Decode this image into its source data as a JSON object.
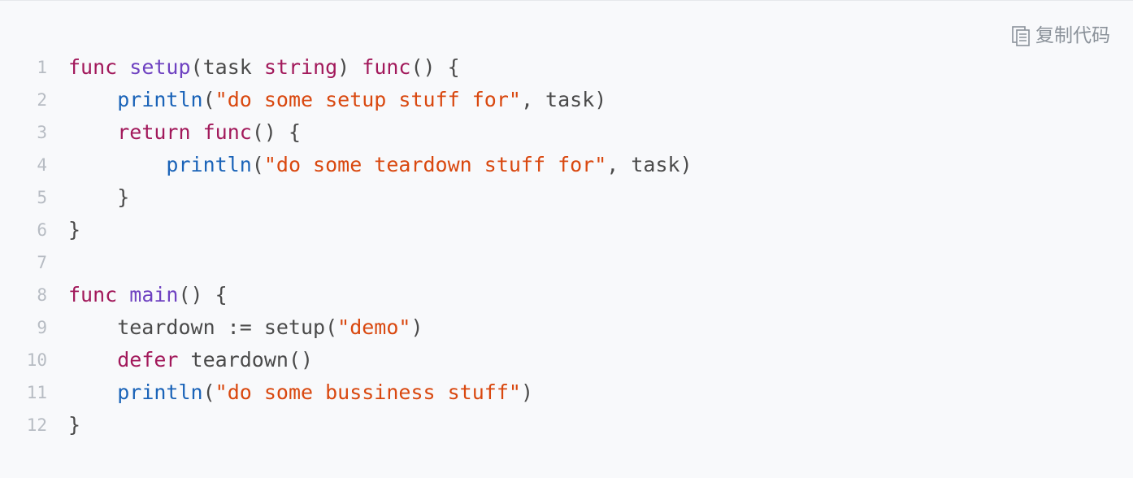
{
  "toolbar": {
    "copy_label": "复制代码",
    "copy_icon": "copy-icon"
  },
  "colors": {
    "background": "#f8f9fb",
    "keyword": "#a2195b",
    "function_name": "#6f42c1",
    "builtin": "#1a63b8",
    "string": "#d9480f",
    "plain": "#4a4a4a",
    "line_number": "#b7bcc3"
  },
  "code": {
    "language": "go",
    "lines": [
      {
        "number": "1",
        "tokens": [
          {
            "text": "func",
            "type": "keyword"
          },
          {
            "text": " ",
            "type": "plain"
          },
          {
            "text": "setup",
            "type": "func"
          },
          {
            "text": "(task ",
            "type": "plain"
          },
          {
            "text": "string",
            "type": "keyword"
          },
          {
            "text": ") ",
            "type": "plain"
          },
          {
            "text": "func",
            "type": "keyword"
          },
          {
            "text": "() {",
            "type": "plain"
          }
        ]
      },
      {
        "number": "2",
        "tokens": [
          {
            "text": "    ",
            "type": "plain"
          },
          {
            "text": "println",
            "type": "builtin"
          },
          {
            "text": "(",
            "type": "plain"
          },
          {
            "text": "\"do some setup stuff for\"",
            "type": "string"
          },
          {
            "text": ", task)",
            "type": "plain"
          }
        ]
      },
      {
        "number": "3",
        "tokens": [
          {
            "text": "    ",
            "type": "plain"
          },
          {
            "text": "return",
            "type": "keyword"
          },
          {
            "text": " ",
            "type": "plain"
          },
          {
            "text": "func",
            "type": "keyword"
          },
          {
            "text": "() {",
            "type": "plain"
          }
        ]
      },
      {
        "number": "4",
        "tokens": [
          {
            "text": "        ",
            "type": "plain"
          },
          {
            "text": "println",
            "type": "builtin"
          },
          {
            "text": "(",
            "type": "plain"
          },
          {
            "text": "\"do some teardown stuff for\"",
            "type": "string"
          },
          {
            "text": ", task)",
            "type": "plain"
          }
        ]
      },
      {
        "number": "5",
        "tokens": [
          {
            "text": "    }",
            "type": "plain"
          }
        ]
      },
      {
        "number": "6",
        "tokens": [
          {
            "text": "}",
            "type": "plain"
          }
        ]
      },
      {
        "number": "7",
        "tokens": []
      },
      {
        "number": "8",
        "tokens": [
          {
            "text": "func",
            "type": "keyword"
          },
          {
            "text": " ",
            "type": "plain"
          },
          {
            "text": "main",
            "type": "func"
          },
          {
            "text": "() {",
            "type": "plain"
          }
        ]
      },
      {
        "number": "9",
        "tokens": [
          {
            "text": "    teardown := setup(",
            "type": "plain"
          },
          {
            "text": "\"demo\"",
            "type": "string"
          },
          {
            "text": ")",
            "type": "plain"
          }
        ]
      },
      {
        "number": "10",
        "tokens": [
          {
            "text": "    ",
            "type": "plain"
          },
          {
            "text": "defer",
            "type": "keyword"
          },
          {
            "text": " teardown()",
            "type": "plain"
          }
        ]
      },
      {
        "number": "11",
        "tokens": [
          {
            "text": "    ",
            "type": "plain"
          },
          {
            "text": "println",
            "type": "builtin"
          },
          {
            "text": "(",
            "type": "plain"
          },
          {
            "text": "\"do some bussiness stuff\"",
            "type": "string"
          },
          {
            "text": ")",
            "type": "plain"
          }
        ]
      },
      {
        "number": "12",
        "tokens": [
          {
            "text": "}",
            "type": "plain"
          }
        ]
      }
    ]
  }
}
